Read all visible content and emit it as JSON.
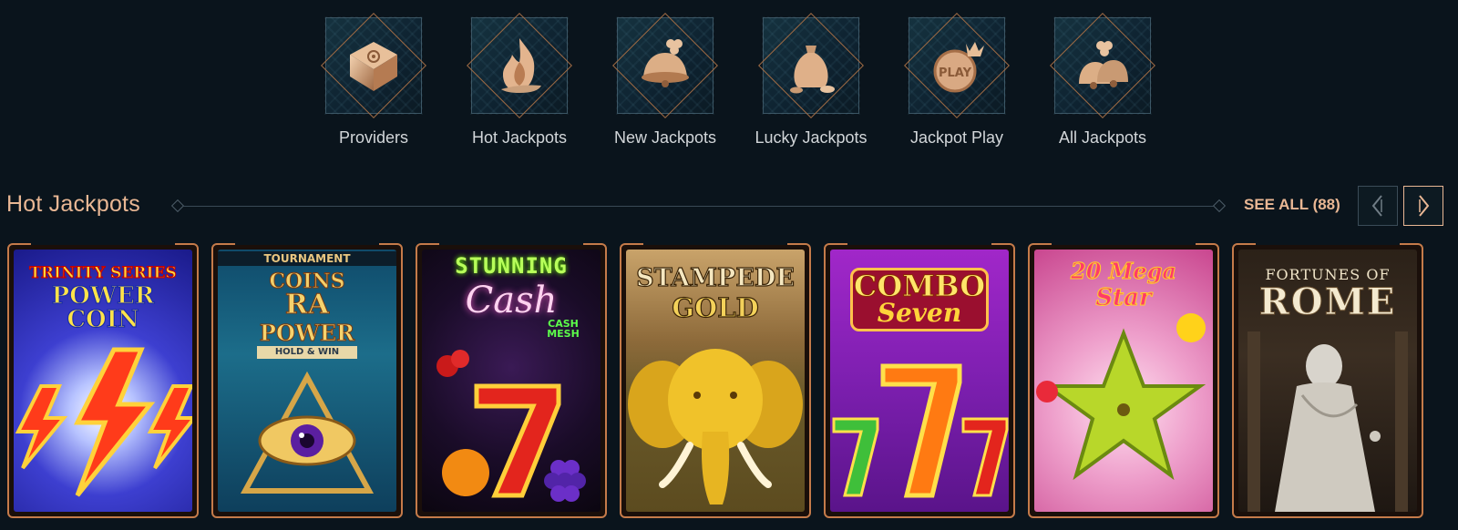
{
  "categories": [
    {
      "label": "Providers",
      "icon": "book-icon"
    },
    {
      "label": "Hot Jackpots",
      "icon": "flame-icon"
    },
    {
      "label": "New Jackpots",
      "icon": "bell-clover-icon"
    },
    {
      "label": "Lucky Jackpots",
      "icon": "money-bag-icon"
    },
    {
      "label": "Jackpot Play",
      "icon": "play-coin-icon"
    },
    {
      "label": "All Jackpots",
      "icon": "bells-icon"
    }
  ],
  "section": {
    "title": "Hot Jackpots",
    "see_all": "SEE ALL (88)",
    "prev_icon": "chevron-left-icon",
    "next_icon": "chevron-right-icon"
  },
  "games": [
    {
      "title_line1": "TRINITY SERIES",
      "title_line2": "POWER COIN"
    },
    {
      "banner": "TOURNAMENT",
      "title_line1": "COINS",
      "title_line2": "RA",
      "title_line3": "POWER",
      "title_line4": "HOLD & WIN"
    },
    {
      "title_line1": "STUNNING",
      "title_line2": "Cash",
      "badge": "CASH MESH"
    },
    {
      "title_line1": "STAMPEDE",
      "title_line2": "GOLD"
    },
    {
      "title_line1": "COMBO",
      "title_line2": "Seven"
    },
    {
      "title_line1": "20 Mega",
      "title_line2": "Star"
    },
    {
      "title_line1": "FORTUNES OF",
      "title_line2": "ROME"
    }
  ],
  "colors": {
    "background": "#0a141c",
    "accent": "#e9b794",
    "card_border": "#c57b4a"
  }
}
